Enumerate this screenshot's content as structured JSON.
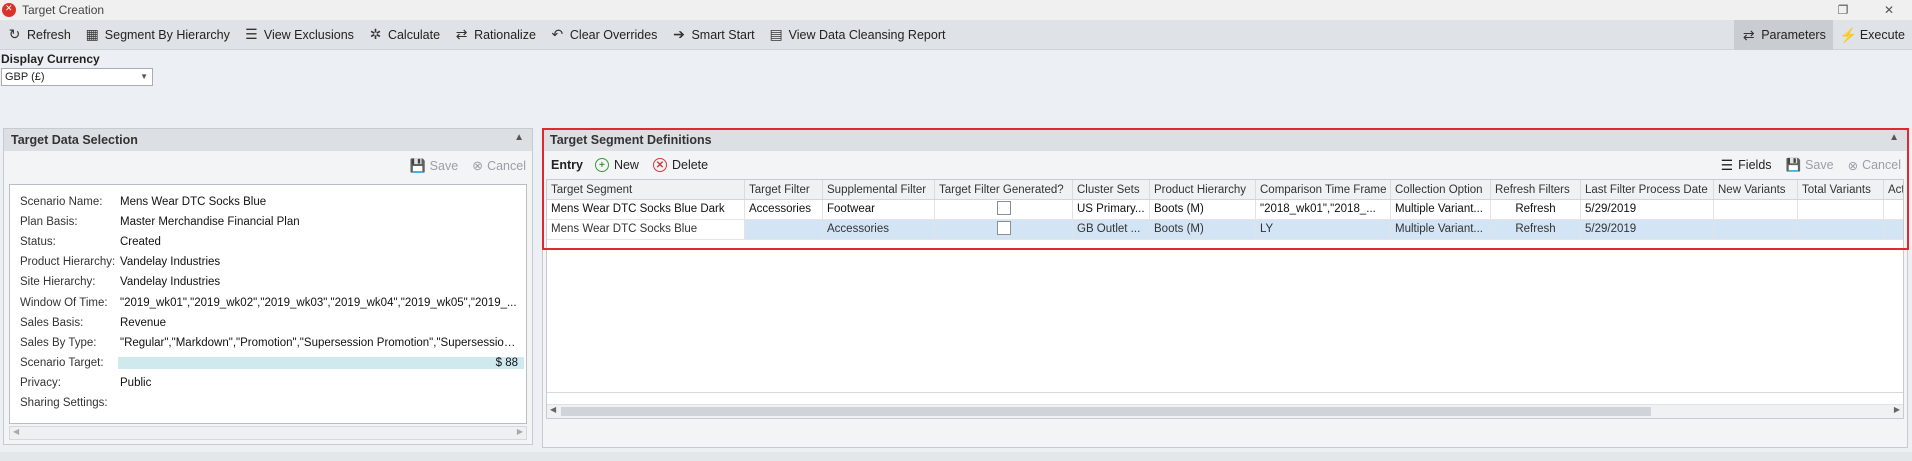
{
  "window": {
    "title": "Target Creation"
  },
  "toolbar": {
    "items": [
      {
        "label": "Refresh",
        "icon": "refresh-icon",
        "glyph": "↻"
      },
      {
        "label": "Segment By Hierarchy",
        "icon": "hierarchy-icon",
        "glyph": "▦"
      },
      {
        "label": "View Exclusions",
        "icon": "list-icon",
        "glyph": "☰"
      },
      {
        "label": "Calculate",
        "icon": "wand-icon",
        "glyph": "✲"
      },
      {
        "label": "Rationalize",
        "icon": "arrows-icon",
        "glyph": "⇄"
      },
      {
        "label": "Clear Overrides",
        "icon": "undo-icon",
        "glyph": "↶"
      },
      {
        "label": "Smart Start",
        "icon": "arrow-right-icon",
        "glyph": "➔"
      },
      {
        "label": "View Data Cleansing Report",
        "icon": "report-icon",
        "glyph": "▤"
      }
    ],
    "right_items": [
      {
        "label": "Parameters",
        "icon": "parameters-icon",
        "glyph": "⇄"
      },
      {
        "label": "Execute",
        "icon": "lightning-icon",
        "glyph": "⚡"
      }
    ]
  },
  "currency": {
    "label": "Display Currency",
    "value": "GBP (£)"
  },
  "left_panel": {
    "title": "Target Data Selection",
    "save_label": "Save",
    "cancel_label": "Cancel",
    "properties": [
      {
        "label": "Scenario Name:",
        "value": "Mens Wear DTC Socks Blue"
      },
      {
        "label": "Plan Basis:",
        "value": "Master Merchandise Financial Plan"
      },
      {
        "label": "Status:",
        "value": "Created"
      },
      {
        "label": "Product Hierarchy:",
        "value": "Vandelay Industries"
      },
      {
        "label": "Site Hierarchy:",
        "value": "Vandelay Industries"
      },
      {
        "label": "Window Of Time:",
        "value": "\"2019_wk01\",\"2019_wk02\",\"2019_wk03\",\"2019_wk04\",\"2019_wk05\",\"2019_..."
      },
      {
        "label": "Sales Basis:",
        "value": "Revenue"
      },
      {
        "label": "Sales By Type:",
        "value": "\"Regular\",\"Markdown\",\"Promotion\",\"Supersession Promotion\",\"Supersession Re..."
      },
      {
        "label": "Scenario Target:",
        "value": "$ 88"
      },
      {
        "label": "Privacy:",
        "value": "Public"
      },
      {
        "label": "Sharing Settings:",
        "value": ""
      }
    ]
  },
  "right_panel": {
    "title": "Target Segment Definitions",
    "entry_label": "Entry",
    "new_label": "New",
    "delete_label": "Delete",
    "fields_label": "Fields",
    "save_label": "Save",
    "cancel_label": "Cancel",
    "columns": [
      "Target Segment",
      "Target Filter",
      "Supplemental Filter",
      "Target Filter Generated?",
      "Cluster Sets",
      "Product Hierarchy",
      "Comparison Time Frame",
      "Collection Option",
      "Refresh Filters",
      "Last Filter Process Date",
      "New Variants",
      "Total Variants",
      "Acti"
    ],
    "rows": [
      [
        "Mens Wear DTC Socks Blue Dark",
        "Accessories",
        "Footwear",
        "",
        "US Primary...",
        "Boots (M)",
        "\"2018_wk01\",\"2018_...",
        "Multiple Variant...",
        "Refresh",
        "5/29/2019",
        "",
        "",
        ""
      ],
      [
        "Mens Wear DTC Socks Blue",
        "",
        "Accessories",
        "",
        "GB Outlet ...",
        "Boots (M)",
        "LY",
        "Multiple Variant...",
        "Refresh",
        "5/29/2019",
        "",
        "",
        ""
      ]
    ]
  }
}
